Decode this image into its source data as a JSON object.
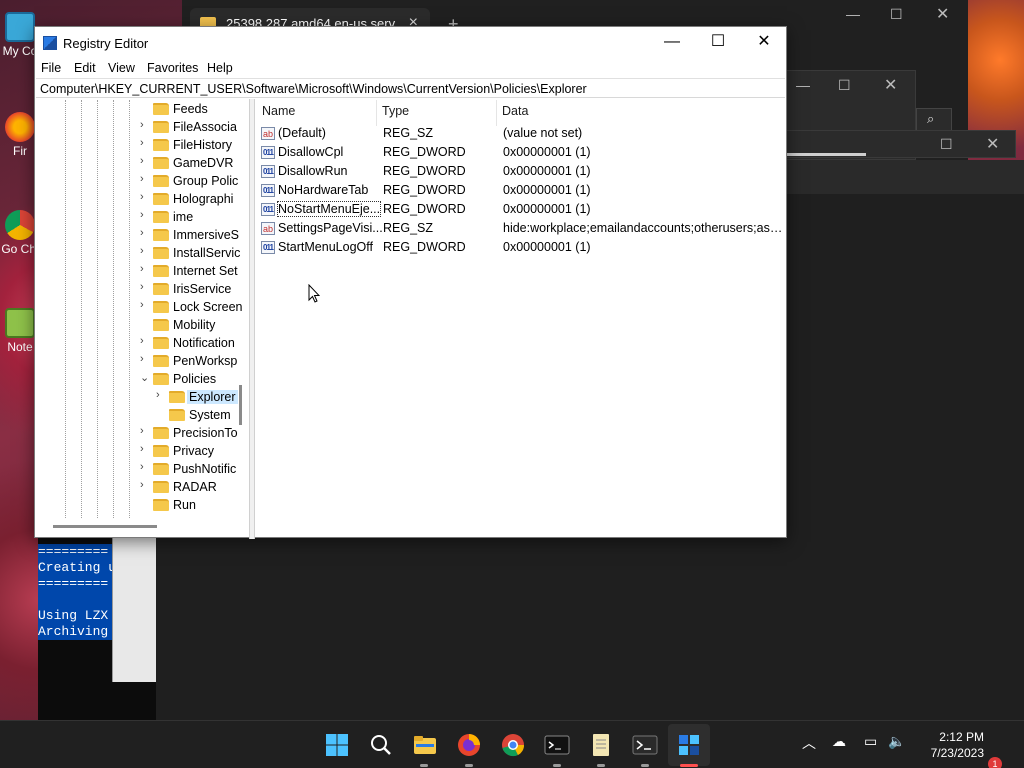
{
  "desktop": {
    "icons": [
      {
        "label": "My Co",
        "icon": "computer-icon"
      },
      {
        "label": "Fir",
        "icon": "firefox-icon"
      },
      {
        "label": "Go Chi",
        "icon": "chrome-icon"
      },
      {
        "label": "Note",
        "icon": "notepad-plus-plus-icon"
      }
    ]
  },
  "background_window": {
    "tab_title": "25398.287.amd64.en-us.serv"
  },
  "terminal": {
    "lines": [
      "=========",
      "Creating u",
      "=========",
      "",
      "Using LZX",
      "Archiving"
    ]
  },
  "regedit": {
    "title": "Registry Editor",
    "menu": [
      "File",
      "Edit",
      "View",
      "Favorites",
      "Help"
    ],
    "address": "Computer\\HKEY_CURRENT_USER\\Software\\Microsoft\\Windows\\CurrentVersion\\Policies\\Explorer",
    "tree": [
      {
        "label": "Feeds",
        "arrow": "",
        "level": 0
      },
      {
        "label": "FileAssocia",
        "arrow": "›",
        "level": 0
      },
      {
        "label": "FileHistory",
        "arrow": "›",
        "level": 0
      },
      {
        "label": "GameDVR",
        "arrow": "›",
        "level": 0
      },
      {
        "label": "Group Polic",
        "arrow": "›",
        "level": 0
      },
      {
        "label": "Holographi",
        "arrow": "›",
        "level": 0
      },
      {
        "label": "ime",
        "arrow": "›",
        "level": 0
      },
      {
        "label": "ImmersiveS",
        "arrow": "›",
        "level": 0
      },
      {
        "label": "InstallServic",
        "arrow": "›",
        "level": 0
      },
      {
        "label": "Internet Set",
        "arrow": "›",
        "level": 0
      },
      {
        "label": "IrisService",
        "arrow": "›",
        "level": 0
      },
      {
        "label": "Lock Screen",
        "arrow": "›",
        "level": 0
      },
      {
        "label": "Mobility",
        "arrow": "",
        "level": 0
      },
      {
        "label": "Notification",
        "arrow": "›",
        "level": 0
      },
      {
        "label": "PenWorksp",
        "arrow": "›",
        "level": 0
      },
      {
        "label": "Policies",
        "arrow": "⌄",
        "level": 0
      },
      {
        "label": "Explorer",
        "arrow": "›",
        "level": 1,
        "selected": true
      },
      {
        "label": "System",
        "arrow": "",
        "level": 1
      },
      {
        "label": "PrecisionTo",
        "arrow": "›",
        "level": 0
      },
      {
        "label": "Privacy",
        "arrow": "›",
        "level": 0
      },
      {
        "label": "PushNotific",
        "arrow": "›",
        "level": 0
      },
      {
        "label": "RADAR",
        "arrow": "›",
        "level": 0
      },
      {
        "label": "Run",
        "arrow": "",
        "level": 0
      }
    ],
    "columns": {
      "name": "Name",
      "type": "Type",
      "data": "Data"
    },
    "values": [
      {
        "name": "(Default)",
        "type": "REG_SZ",
        "data": "(value not set)",
        "icon": "ab"
      },
      {
        "name": "DisallowCpl",
        "type": "REG_DWORD",
        "data": "0x00000001 (1)",
        "icon": "dw"
      },
      {
        "name": "DisallowRun",
        "type": "REG_DWORD",
        "data": "0x00000001 (1)",
        "icon": "dw"
      },
      {
        "name": "NoHardwareTab",
        "type": "REG_DWORD",
        "data": "0x00000001 (1)",
        "icon": "dw"
      },
      {
        "name": "NoStartMenuEje...",
        "type": "REG_DWORD",
        "data": "0x00000001 (1)",
        "icon": "dw",
        "focused": true
      },
      {
        "name": "SettingsPageVisi...",
        "type": "REG_SZ",
        "data": "hide:workplace;emailandaccounts;otherusers;assig...",
        "icon": "ab"
      },
      {
        "name": "StartMenuLogOff",
        "type": "REG_DWORD",
        "data": "0x00000001 (1)",
        "icon": "dw"
      }
    ]
  },
  "taskbar": {
    "apps": [
      "start-icon",
      "search-icon",
      "file-explorer-icon",
      "firefox-icon",
      "chrome-icon",
      "terminal-icon",
      "notepad-icon",
      "powershell-icon",
      "registry-editor-icon"
    ],
    "time": "2:12 PM",
    "date": "7/23/2023",
    "notification_count": "1"
  },
  "colors": {
    "accent": "#0078d4",
    "folder": "#f5c84b",
    "selection": "#cce8ff",
    "taskbar": "#202020"
  }
}
